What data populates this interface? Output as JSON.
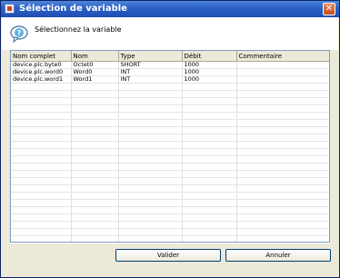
{
  "window": {
    "title": "Sélection de variable",
    "close_glyph": "✕",
    "colors": {
      "titlebar": "#2a5fc4",
      "frame": "#ece9d8",
      "close": "#c64b1c"
    }
  },
  "header": {
    "prompt": "Sélectionnez la variable",
    "icon": "question-bubble-icon"
  },
  "table": {
    "columns": [
      "Nom complet",
      "Nom",
      "Type",
      "Débit",
      "Commentaire"
    ],
    "rows": [
      [
        "device.plc.byte0",
        "Octet0",
        "SHORT",
        "1000",
        ""
      ],
      [
        "device.plc.word0",
        "Word0",
        "INT",
        "1000",
        ""
      ],
      [
        "device.plc.word1",
        "Word1",
        "INT",
        "1000",
        ""
      ]
    ],
    "empty_row_count": 24
  },
  "buttons": {
    "ok": "Valider",
    "cancel": "Annuler"
  }
}
